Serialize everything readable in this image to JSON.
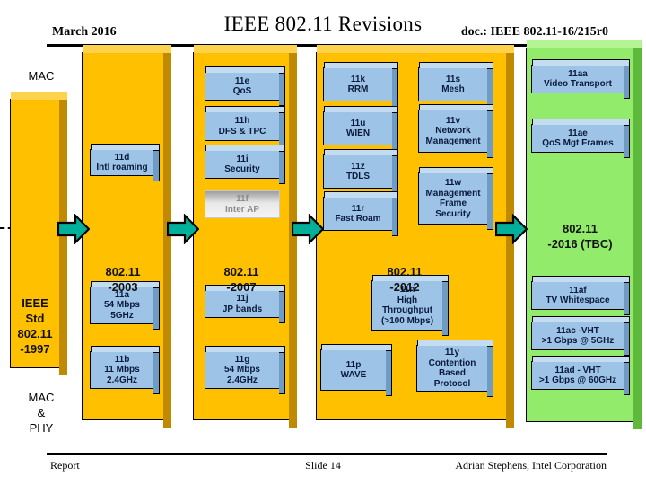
{
  "header": {
    "date": "March 2016",
    "title": "IEEE 802.11 Revisions",
    "doc": "doc.: IEEE 802.11-16/215r0"
  },
  "footer": {
    "left": "Report",
    "center": "Slide 14",
    "right": "Adrian Stephens, Intel Corporation"
  },
  "side_labels": {
    "mac": "MAC",
    "mac_phy": "MAC\n&\nPHY"
  },
  "colors": {
    "column_orange": "#FFC000",
    "column_green": "#92EB6B",
    "feature_blue": "#9DC3E6",
    "arrow_green": "#00B09B",
    "withdrawn_grey": "#BFBFBF"
  },
  "columns": [
    {
      "id": "col-1997",
      "title": "IEEE\nStd\n802.11\n-1997",
      "color": "orange",
      "features": []
    },
    {
      "id": "col-2003",
      "title": "802.11\n-2003",
      "color": "orange",
      "features": [
        {
          "name": "11d",
          "detail": "Intl roaming",
          "state": "active"
        },
        {
          "name": "11a",
          "detail": "54 Mbps\n5GHz",
          "state": "active"
        },
        {
          "name": "11b",
          "detail": "11 Mbps\n2.4GHz",
          "state": "active"
        }
      ]
    },
    {
      "id": "col-2007",
      "title": "802.11\n-2007",
      "color": "orange",
      "features": [
        {
          "name": "11e",
          "detail": "QoS",
          "state": "active"
        },
        {
          "name": "11h",
          "detail": "DFS & TPC",
          "state": "active"
        },
        {
          "name": "11i",
          "detail": "Security",
          "state": "active"
        },
        {
          "name": "11f",
          "detail": "Inter AP",
          "state": "withdrawn"
        },
        {
          "name": "11j",
          "detail": "JP bands",
          "state": "active"
        },
        {
          "name": "11g",
          "detail": "54 Mbps\n2.4GHz",
          "state": "active"
        }
      ]
    },
    {
      "id": "col-2012",
      "title": "802.11\n-2012",
      "color": "orange",
      "features": [
        {
          "name": "11k",
          "detail": "RRM",
          "state": "active"
        },
        {
          "name": "11s",
          "detail": "Mesh",
          "state": "active"
        },
        {
          "name": "11u",
          "detail": "WIEN",
          "state": "active"
        },
        {
          "name": "11v",
          "detail": "Network\nManagement",
          "state": "active"
        },
        {
          "name": "11z",
          "detail": "TDLS",
          "state": "active"
        },
        {
          "name": "11w",
          "detail": "Management\nFrame\nSecurity",
          "state": "active"
        },
        {
          "name": "11r",
          "detail": "Fast Roam",
          "state": "active"
        },
        {
          "name": "11n",
          "detail": "High\nThroughput\n(>100 Mbps)",
          "state": "active"
        },
        {
          "name": "11p",
          "detail": "WAVE",
          "state": "active"
        },
        {
          "name": "11y",
          "detail": "Contention\nBased\nProtocol",
          "state": "active"
        }
      ]
    },
    {
      "id": "col-2016",
      "title": "802.11\n-2016 (TBC)",
      "color": "green",
      "features": [
        {
          "name": "11aa",
          "detail": "Video Transport",
          "state": "active"
        },
        {
          "name": "11ae",
          "detail": "QoS Mgt Frames",
          "state": "active"
        },
        {
          "name": "11af",
          "detail": "TV Whitespace",
          "state": "active"
        },
        {
          "name": "11ac -VHT",
          "detail": ">1 Gbps @ 5GHz",
          "state": "active"
        },
        {
          "name": "11ad - VHT",
          "detail": ">1 Gbps @ 60GHz",
          "state": "active"
        }
      ]
    }
  ],
  "boxes": {
    "b_11d": "11d\nIntl roaming",
    "b_11a": "11a\n54 Mbps\n5GHz",
    "b_11b": "11b\n11 Mbps\n2.4GHz",
    "b_11e": "11e\nQoS",
    "b_11h": "11h\nDFS & TPC",
    "b_11i": "11i\nSecurity",
    "b_11f": "11f\nInter AP",
    "b_11j": "11j\nJP bands",
    "b_11g": "11g\n54 Mbps\n2.4GHz",
    "b_11k": "11k\nRRM",
    "b_11s": "11s\nMesh",
    "b_11u": "11u\nWIEN",
    "b_11v": "11v\nNetwork\nManagement",
    "b_11z": "11z\nTDLS",
    "b_11w": "11w\nManagement\nFrame\nSecurity",
    "b_11r": "11r\nFast Roam",
    "b_11n": "11n\nHigh\nThroughput\n(>100 Mbps)",
    "b_11p": "11p\nWAVE",
    "b_11y": "11y\nContention\nBased\nProtocol",
    "b_11aa": "11aa\nVideo Transport",
    "b_11ae": "11ae\nQoS Mgt Frames",
    "b_11af": "11af\nTV Whitespace",
    "b_11ac": "11ac -VHT\n>1 Gbps @ 5GHz",
    "b_11ad": "11ad - VHT\n>1 Gbps @ 60GHz"
  },
  "column_titles": {
    "t1997": "IEEE\nStd\n802.11\n-1997",
    "t2003": "802.11\n-2003",
    "t2007": "802.11\n-2007",
    "t2012": "802.11\n-2012",
    "t2016": "802.11\n-2016 (TBC)"
  },
  "arrows": [
    {
      "name": "arrow-1997-to-2003"
    },
    {
      "name": "arrow-2003-to-2007"
    },
    {
      "name": "arrow-2007-to-2012"
    },
    {
      "name": "arrow-2012-to-2016"
    }
  ]
}
